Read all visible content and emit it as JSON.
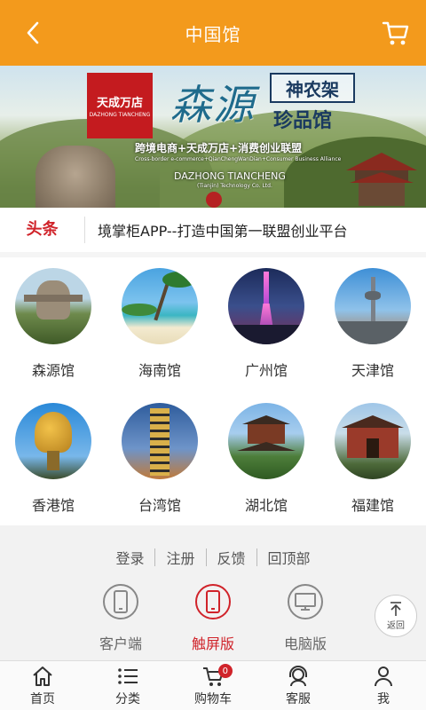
{
  "header": {
    "title": "中国馆",
    "back_icon": "chevron-left-icon",
    "cart_icon": "cart-icon",
    "background_color": "#f39a1c"
  },
  "banner": {
    "logo_text": "天成万店",
    "logo_sub": "DAZHONG TIANCHENG",
    "headline": "森源",
    "box_title": "神农架",
    "box_subtitle": "珍品馆",
    "slogan": "跨境电商+天成万店+消费创业联盟",
    "slogan_en": "Cross-border e-commerce+QianChengWanDian+Consumer Business Alliance",
    "company": "DAZHONG TIANCHENG",
    "company_sub": "(Tianjin) Technology Co. Ltd."
  },
  "news": {
    "label": "头条",
    "text": "境掌柜APP--打造中国第一联盟创业平台"
  },
  "pavilions": [
    {
      "name": "森源馆"
    },
    {
      "name": "海南馆"
    },
    {
      "name": "广州馆"
    },
    {
      "name": "天津馆"
    },
    {
      "name": "香港馆"
    },
    {
      "name": "台湾馆"
    },
    {
      "name": "湖北馆"
    },
    {
      "name": "福建馆"
    }
  ],
  "footer": {
    "links": [
      "登录",
      "注册",
      "反馈",
      "回顶部"
    ],
    "versions": [
      {
        "label": "客户端",
        "icon": "phone-icon",
        "active": false
      },
      {
        "label": "触屏版",
        "icon": "touch-phone-icon",
        "active": true
      },
      {
        "label": "电脑版",
        "icon": "monitor-icon",
        "active": false
      }
    ],
    "back_to_top": "返回",
    "active_color": "#d0232a"
  },
  "tabbar": {
    "items": [
      {
        "label": "首页",
        "icon": "home-icon"
      },
      {
        "label": "分类",
        "icon": "list-icon"
      },
      {
        "label": "购物车",
        "icon": "cart-icon",
        "badge": "0"
      },
      {
        "label": "客服",
        "icon": "headset-icon"
      },
      {
        "label": "我",
        "icon": "user-icon"
      }
    ]
  }
}
